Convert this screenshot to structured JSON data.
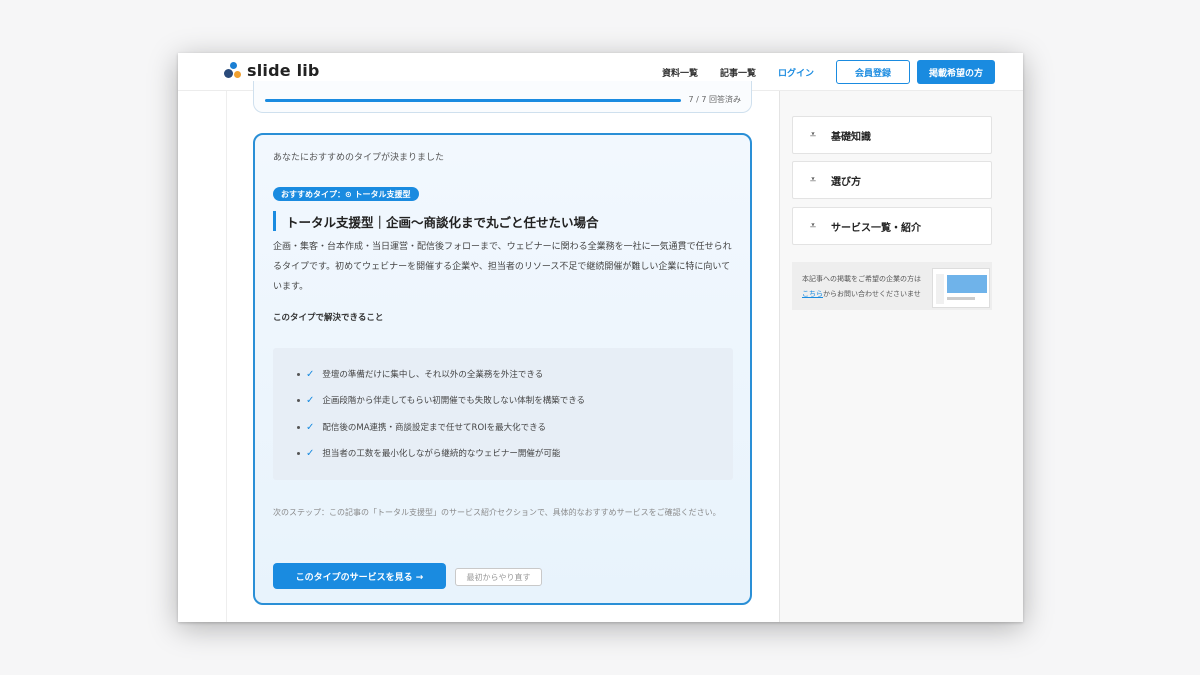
{
  "header": {
    "logo_text": "slide lib",
    "nav": [
      "資料一覧",
      "記事一覧",
      "ログイン"
    ],
    "register_label": "会員登録",
    "listing_label": "掲載希望の方"
  },
  "progress": {
    "text": "7 / 7 回答済み",
    "fraction": 1.0
  },
  "result": {
    "intro": "あなたにおすすめのタイプが決まりました",
    "badge": "おすすめタイプ：⊙ トータル支援型",
    "title": "トータル支援型｜企画〜商談化まで丸ごと任せたい場合",
    "description": "企画・集客・台本作成・当日運営・配信後フォローまで、ウェビナーに関わる全業務を一社に一気通貫で任せられるタイプです。初めてウェビナーを開催する企業や、担当者のリソース不足で継続開催が難しい企業に特に向いています。",
    "solves_heading": "このタイプで解決できること",
    "benefits": [
      "登壇の準備だけに集中し、それ以外の全業務を外注できる",
      "企画段階から伴走してもらい初開催でも失敗しない体制を構築できる",
      "配信後のMA連携・商談設定まで任せてROIを最大化できる",
      "担当者の工数を最小化しながら継続的なウェビナー開催が可能"
    ],
    "next_step": "次のステップ：この記事の「トータル支援型」のサービス紹介セクションで、具体的なおすすめサービスをご確認ください。",
    "cta_label": "このタイプのサービスを見る →",
    "reset_label": "最初からやり直す"
  },
  "sidebar": {
    "items": [
      {
        "label": "基礎知識",
        "icon": "download-chevron-icon"
      },
      {
        "label": "選び方",
        "icon": "download-chevron-icon"
      },
      {
        "label": "サービス一覧・紹介",
        "icon": "download-chevron-icon"
      }
    ],
    "ad": {
      "line1": "本記事への掲載をご希望の企業の方は",
      "link": "こちら",
      "line2_rest": "からお問い合わせくださいませ"
    }
  },
  "colors": {
    "accent": "#1a8be0",
    "card_border": "#2a8fd6",
    "card_bg": "#eef6fd"
  }
}
